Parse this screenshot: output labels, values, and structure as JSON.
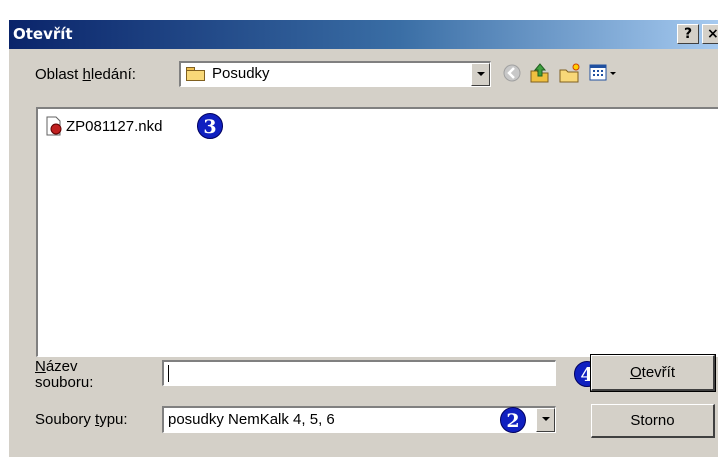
{
  "window": {
    "title": "Otevřít",
    "help_label": "?",
    "close_label": "×"
  },
  "look_in": {
    "label_prefix": "Oblast ",
    "label_access": "h",
    "label_suffix": "ledání:",
    "value": "Posudky"
  },
  "toolbar": {
    "icons": [
      "back-icon",
      "up-folder-icon",
      "new-folder-icon",
      "view-menu-icon"
    ]
  },
  "files": [
    {
      "name": "ZP081127.nkd",
      "icon": "nkd-file-icon"
    }
  ],
  "filename": {
    "label_access": "N",
    "label_line1_rest": "ázev",
    "label_line2": "souboru:",
    "value": ""
  },
  "filetype": {
    "label_prefix": "Soubory ",
    "label_access": "t",
    "label_suffix": "ypu:",
    "value": "posudky NemKalk 4, 5, 6"
  },
  "buttons": {
    "open_access": "O",
    "open_rest": "tevřít",
    "cancel": "Storno"
  },
  "badges": {
    "file_type": "2",
    "file_item": "3",
    "open_button": "4"
  },
  "colors": {
    "title_gradient_start": "#0a246a",
    "title_gradient_end": "#a6caf0",
    "dialog_face": "#d4d0c8",
    "badge": "#1020c0"
  }
}
